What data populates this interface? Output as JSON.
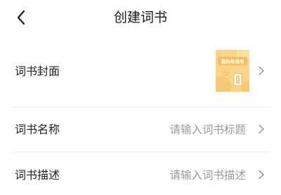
{
  "nav": {
    "title": "创建词书"
  },
  "rows": {
    "cover": {
      "label": "词书封面",
      "cover_text": "我的单词书"
    },
    "name": {
      "label": "词书名称",
      "placeholder": "请输入词书标题"
    },
    "desc": {
      "label": "词书描述",
      "placeholder": "请输入词书描述"
    }
  },
  "colors": {
    "background": "#ffffff",
    "text": "#1f1f1f",
    "placeholder": "#9a9a9a",
    "divider": "#ececec",
    "cover": "#f9d489"
  },
  "icons": {
    "back": "back-arrow-icon",
    "chevron": "chevron-right-icon"
  }
}
